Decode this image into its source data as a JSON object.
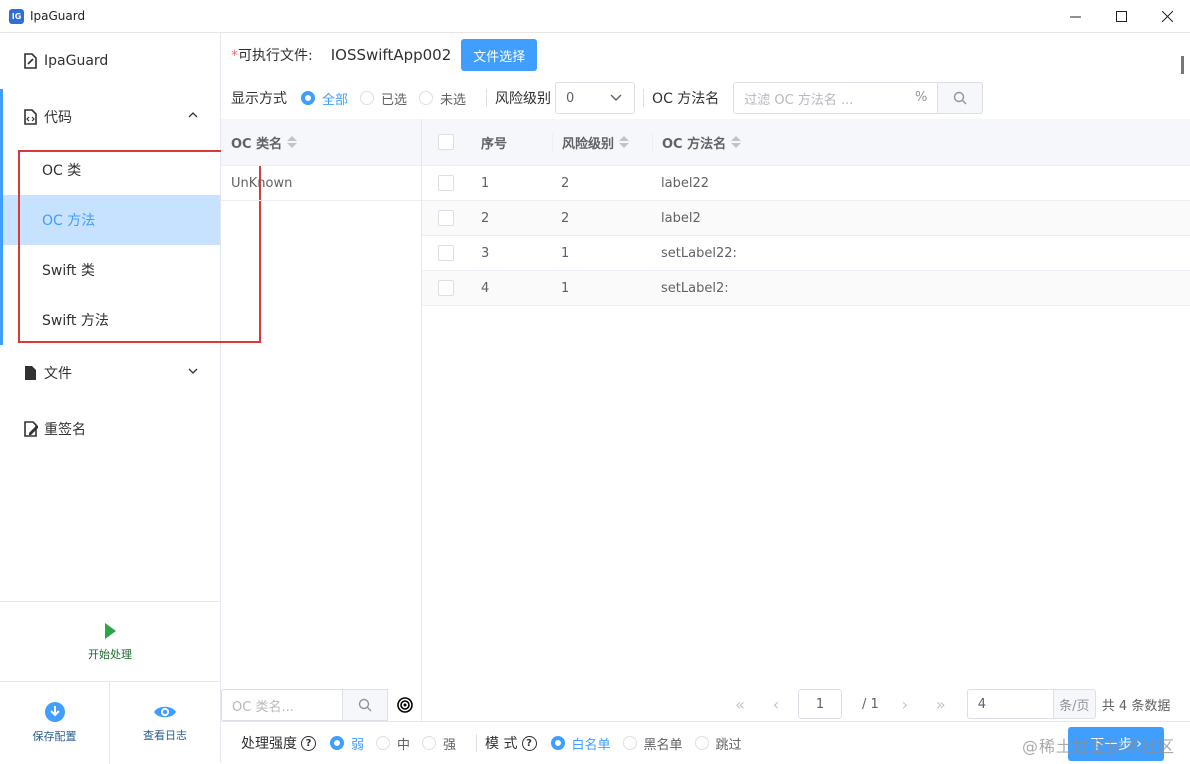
{
  "window": {
    "title": "IpaGuard",
    "logo_text": "IG"
  },
  "sidebar": {
    "items": [
      {
        "label": "IpaGuard",
        "icon": "file-icon"
      },
      {
        "label": "代码",
        "icon": "code-file-icon",
        "expanded": true
      },
      {
        "label": "文件",
        "icon": "document-icon",
        "expanded": false
      },
      {
        "label": "重签名",
        "icon": "sign-icon"
      }
    ],
    "sub_items": [
      {
        "label": "OC 类"
      },
      {
        "label": "OC 方法",
        "active": true
      },
      {
        "label": "Swift 类"
      },
      {
        "label": "Swift 方法"
      }
    ],
    "start_label": "开始处理",
    "save_label": "保存配置",
    "log_label": "查看日志"
  },
  "toolbar": {
    "exec_label": "可执行文件:",
    "exec_star": "*",
    "exec_value": "IOSSwiftApp002",
    "choose_button": "文件选择",
    "display_label": "显示方式",
    "display_options": [
      "全部",
      "已选",
      "未选"
    ],
    "display_selected": "全部",
    "risk_label": "风险级别",
    "risk_value": "0",
    "method_label": "OC 方法名",
    "method_placeholder": "过滤 OC 方法名 ...",
    "method_pct": "%"
  },
  "class_table": {
    "header": "OC 类名",
    "rows": [
      "UnKnown"
    ],
    "search_placeholder": "OC 类名..."
  },
  "method_table": {
    "headers": [
      "序号",
      "风险级别",
      "OC 方法名"
    ],
    "rows": [
      {
        "idx": "1",
        "risk": "2",
        "name": "label22"
      },
      {
        "idx": "2",
        "risk": "2",
        "name": "label2"
      },
      {
        "idx": "3",
        "risk": "1",
        "name": "setLabel22:"
      },
      {
        "idx": "4",
        "risk": "1",
        "name": "setLabel2:"
      }
    ]
  },
  "pager": {
    "current": "1",
    "total_pages": "/ 1",
    "page_size": "4",
    "unit": "条/页",
    "summary": "共 4 条数据"
  },
  "options": {
    "strength_label": "处理强度",
    "strength_options": [
      "弱",
      "中",
      "强"
    ],
    "strength_selected": "弱",
    "mode_label": "模 式",
    "mode_options": [
      "白名单",
      "黑名单",
      "跳过"
    ],
    "mode_selected": "白名单",
    "next_button": "下一步",
    "help_mark": "?"
  },
  "watermark": "@稀土掘金技术社区",
  "colors": {
    "primary": "#409eff",
    "active_bg": "#c6e2ff",
    "highlight_box": "#d9393b",
    "start_green": "#2aa54a"
  }
}
